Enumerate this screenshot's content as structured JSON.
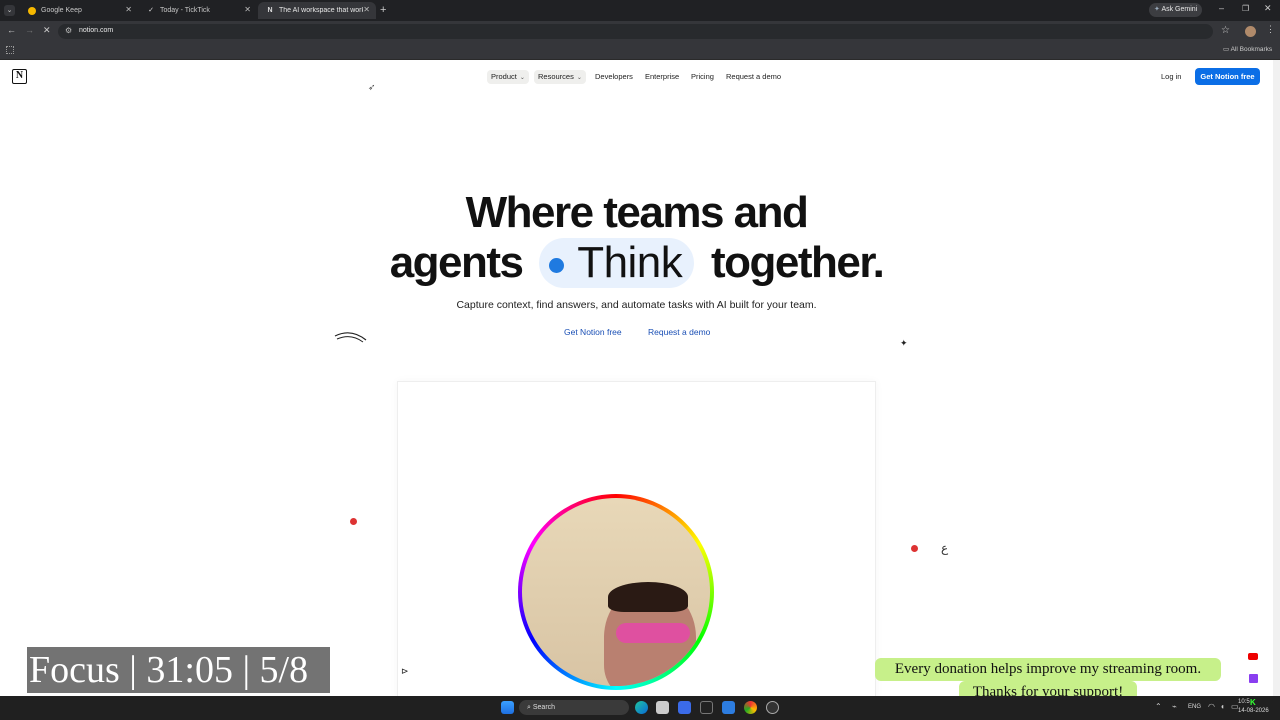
{
  "browser": {
    "tabs": [
      {
        "title": "Google Keep"
      },
      {
        "title": "Today - TickTick"
      },
      {
        "title": "The AI workspace that works fo..."
      }
    ],
    "ask_gemini": "Ask Gemini",
    "url": "notion.com",
    "bookmarks_label": "All Bookmarks"
  },
  "notion": {
    "nav": [
      {
        "label": "Product"
      },
      {
        "label": "Resources"
      },
      {
        "label": "Developers"
      },
      {
        "label": "Enterprise"
      },
      {
        "label": "Pricing"
      },
      {
        "label": "Request a demo"
      }
    ],
    "login": "Log in",
    "cta": "Get Notion free",
    "hero_line1": "Where teams and",
    "hero_line2a": "agents",
    "hero_pill": "Think",
    "hero_line2b": "together.",
    "subtitle": "Capture context, find answers, and automate tasks with AI built for your team.",
    "cta_primary": "Get Notion free",
    "cta_secondary": "Request a demo"
  },
  "overlay": {
    "focus_timer": "Focus | 31:05 | 5/8",
    "donation_line1": "Every donation helps improve my streaming room.",
    "donation_line2": "Thanks for your support!"
  },
  "taskbar": {
    "search": "Search",
    "lang": "ENG",
    "time": "10:5",
    "date": "14-08-2026"
  },
  "colors": {
    "accent": "#0b6ee6",
    "chrome_dark": "#202124",
    "chrome_mid": "#35363a",
    "donation_bg": "#c7f08a"
  }
}
